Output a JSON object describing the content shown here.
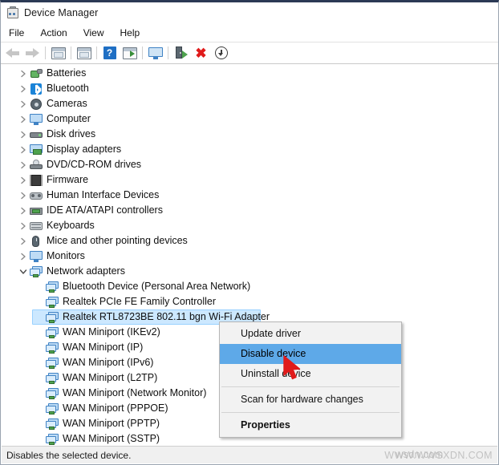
{
  "window": {
    "title": "Device Manager",
    "app_icon": "device-manager-icon"
  },
  "menubar": {
    "items": [
      {
        "label": "File"
      },
      {
        "label": "Action"
      },
      {
        "label": "View"
      },
      {
        "label": "Help"
      }
    ]
  },
  "toolbar": {
    "buttons": [
      {
        "icon": "back-arrow-icon",
        "label": "Back"
      },
      {
        "icon": "forward-arrow-icon",
        "label": "Forward"
      },
      {
        "icon": "show-hide-console-tree-icon",
        "label": "Show/Hide console tree"
      },
      {
        "icon": "properties-icon",
        "label": "Properties"
      },
      {
        "icon": "help-icon",
        "label": "Help"
      },
      {
        "icon": "update-driver-icon",
        "label": "Update driver"
      },
      {
        "icon": "scan-hardware-changes-icon",
        "label": "Scan for hardware changes"
      },
      {
        "icon": "enable-device-icon",
        "label": "Enable device"
      },
      {
        "icon": "uninstall-device-icon",
        "label": "Uninstall device"
      },
      {
        "icon": "disable-device-icon",
        "label": "Disable device"
      }
    ]
  },
  "tree": {
    "nodes": [
      {
        "label": "Batteries",
        "icon": "battery-icon",
        "expanded": false,
        "level": 1,
        "selected": false
      },
      {
        "label": "Bluetooth",
        "icon": "bluetooth-icon",
        "expanded": false,
        "level": 1,
        "selected": false
      },
      {
        "label": "Cameras",
        "icon": "camera-icon",
        "expanded": false,
        "level": 1,
        "selected": false
      },
      {
        "label": "Computer",
        "icon": "computer-icon",
        "expanded": false,
        "level": 1,
        "selected": false
      },
      {
        "label": "Disk drives",
        "icon": "disk-drive-icon",
        "expanded": false,
        "level": 1,
        "selected": false
      },
      {
        "label": "Display adapters",
        "icon": "display-adapter-icon",
        "expanded": false,
        "level": 1,
        "selected": false
      },
      {
        "label": "DVD/CD-ROM drives",
        "icon": "dvd-drive-icon",
        "expanded": false,
        "level": 1,
        "selected": false
      },
      {
        "label": "Firmware",
        "icon": "firmware-icon",
        "expanded": false,
        "level": 1,
        "selected": false
      },
      {
        "label": "Human Interface Devices",
        "icon": "hid-icon",
        "expanded": false,
        "level": 1,
        "selected": false
      },
      {
        "label": "IDE ATA/ATAPI controllers",
        "icon": "ide-controller-icon",
        "expanded": false,
        "level": 1,
        "selected": false
      },
      {
        "label": "Keyboards",
        "icon": "keyboard-icon",
        "expanded": false,
        "level": 1,
        "selected": false
      },
      {
        "label": "Mice and other pointing devices",
        "icon": "mouse-icon",
        "expanded": false,
        "level": 1,
        "selected": false
      },
      {
        "label": "Monitors",
        "icon": "monitor-icon",
        "expanded": false,
        "level": 1,
        "selected": false
      },
      {
        "label": "Network adapters",
        "icon": "network-adapter-icon",
        "expanded": true,
        "level": 1,
        "selected": false
      },
      {
        "label": "Bluetooth Device (Personal Area Network)",
        "icon": "network-adapter-icon",
        "expanded": null,
        "level": 2,
        "selected": false
      },
      {
        "label": "Realtek PCIe FE Family Controller",
        "icon": "network-adapter-icon",
        "expanded": null,
        "level": 2,
        "selected": false
      },
      {
        "label": "Realtek RTL8723BE 802.11 bgn Wi-Fi Adapter",
        "icon": "network-adapter-icon",
        "expanded": null,
        "level": 2,
        "selected": true
      },
      {
        "label": "WAN Miniport (IKEv2)",
        "icon": "network-adapter-icon",
        "expanded": null,
        "level": 2,
        "selected": false
      },
      {
        "label": "WAN Miniport (IP)",
        "icon": "network-adapter-icon",
        "expanded": null,
        "level": 2,
        "selected": false
      },
      {
        "label": "WAN Miniport (IPv6)",
        "icon": "network-adapter-icon",
        "expanded": null,
        "level": 2,
        "selected": false
      },
      {
        "label": "WAN Miniport (L2TP)",
        "icon": "network-adapter-icon",
        "expanded": null,
        "level": 2,
        "selected": false
      },
      {
        "label": "WAN Miniport (Network Monitor)",
        "icon": "network-adapter-icon",
        "expanded": null,
        "level": 2,
        "selected": false
      },
      {
        "label": "WAN Miniport (PPPOE)",
        "icon": "network-adapter-icon",
        "expanded": null,
        "level": 2,
        "selected": false
      },
      {
        "label": "WAN Miniport (PPTP)",
        "icon": "network-adapter-icon",
        "expanded": null,
        "level": 2,
        "selected": false
      },
      {
        "label": "WAN Miniport (SSTP)",
        "icon": "network-adapter-icon",
        "expanded": null,
        "level": 2,
        "selected": false
      }
    ]
  },
  "context_menu": {
    "items": [
      {
        "label": "Update driver",
        "type": "item",
        "highlighted": false,
        "bold": false
      },
      {
        "label": "Disable device",
        "type": "item",
        "highlighted": true,
        "bold": false
      },
      {
        "label": "Uninstall device",
        "type": "item",
        "highlighted": false,
        "bold": false
      },
      {
        "label": "",
        "type": "separator"
      },
      {
        "label": "Scan for hardware changes",
        "type": "item",
        "highlighted": false,
        "bold": false
      },
      {
        "label": "",
        "type": "separator"
      },
      {
        "label": "Properties",
        "type": "item",
        "highlighted": false,
        "bold": true
      }
    ]
  },
  "statusbar": {
    "text": "Disables the selected device.",
    "watermark": "WWW.WWSXDN.COM",
    "watermark_overlay": "wsdn.com"
  },
  "colors": {
    "selection_fill": "#cce8ff",
    "selection_border": "#99d1ff",
    "menu_highlight": "#5ea9e8",
    "cursor": "#e01b1b",
    "titlebar_accent": "#2b3a55"
  }
}
